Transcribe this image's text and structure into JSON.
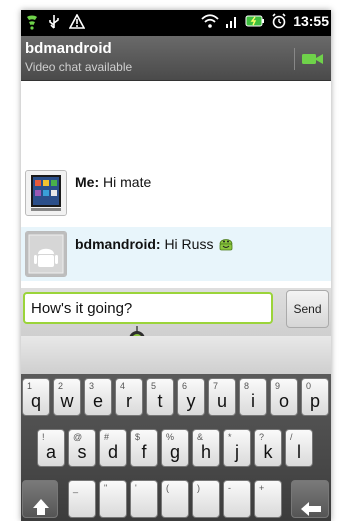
{
  "status_bar": {
    "time": "13:55",
    "icons": [
      "usb-icon",
      "notification-icon",
      "warning-icon",
      "wifi-icon",
      "signal-icon",
      "battery-icon",
      "alarm-icon"
    ]
  },
  "header": {
    "contact_name": "bdmandroid",
    "status": "Video chat available"
  },
  "messages": [
    {
      "sender": "Me:",
      "text": "Hi mate"
    },
    {
      "sender": "bdmandroid:",
      "text": "Hi Russ"
    }
  ],
  "compose": {
    "input_value": "How's it going?",
    "send_label": "Send"
  },
  "keyboard": {
    "row1": [
      {
        "alt": "1",
        "main": "q"
      },
      {
        "alt": "2",
        "main": "w"
      },
      {
        "alt": "3",
        "main": "e"
      },
      {
        "alt": "4",
        "main": "r"
      },
      {
        "alt": "5",
        "main": "t"
      },
      {
        "alt": "6",
        "main": "y"
      },
      {
        "alt": "7",
        "main": "u"
      },
      {
        "alt": "8",
        "main": "i"
      },
      {
        "alt": "9",
        "main": "o"
      },
      {
        "alt": "0",
        "main": "p"
      }
    ],
    "row2": [
      {
        "alt": "!",
        "main": "a"
      },
      {
        "alt": "@",
        "main": "s"
      },
      {
        "alt": "#",
        "main": "d"
      },
      {
        "alt": "$",
        "main": "f"
      },
      {
        "alt": "%",
        "main": "g"
      },
      {
        "alt": "&",
        "main": "h"
      },
      {
        "alt": "*",
        "main": "j"
      },
      {
        "alt": "?",
        "main": "k"
      },
      {
        "alt": "/",
        "main": "l"
      }
    ],
    "row3_alts": [
      "_",
      "\"",
      "'",
      "(",
      ")",
      "-",
      "+"
    ]
  },
  "colors": {
    "accent_green": "#9bd43a",
    "bubble_other": "#e8f5fb",
    "title_bar": "#555555"
  }
}
